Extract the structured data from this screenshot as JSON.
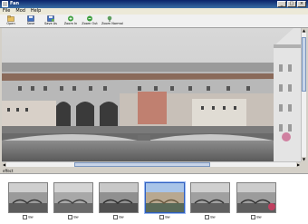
{
  "window": {
    "title": "Fan",
    "buttons": [
      "_",
      "□",
      "×"
    ]
  },
  "menu": [
    "File",
    "Mod",
    "Help"
  ],
  "toolbar": [
    {
      "label": "Open",
      "icon": "open-icon"
    },
    {
      "label": "Save",
      "icon": "save-icon"
    },
    {
      "label": "Save As",
      "icon": "save-as-icon"
    },
    {
      "label": "Zoom In",
      "icon": "zoom-in-icon"
    },
    {
      "label": "Zoom Out",
      "icon": "zoom-out-icon"
    },
    {
      "label": "Zoom Normal",
      "icon": "zoom-normal-icon"
    }
  ],
  "effect_label": "effect",
  "thumbnails": [
    {
      "caption": "Bw",
      "style": "bw"
    },
    {
      "caption": "Bw",
      "style": "bw"
    },
    {
      "caption": "Bw",
      "style": "bw"
    },
    {
      "caption": "Bw",
      "style": "color"
    },
    {
      "caption": "Bw",
      "style": "bw"
    },
    {
      "caption": "Bw",
      "style": "bw-red"
    }
  ],
  "colors": {
    "accent": "#0a246a",
    "selection": "#3060c0"
  }
}
